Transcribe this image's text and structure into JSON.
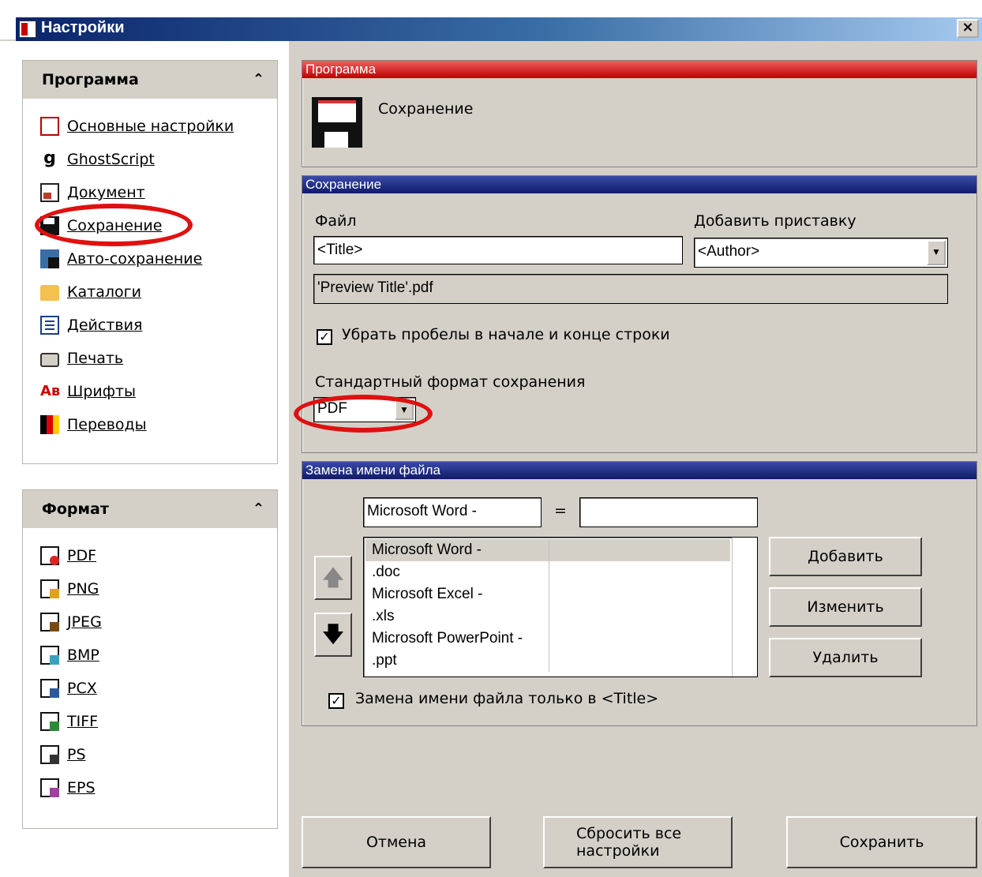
{
  "window": {
    "title": "Настройки",
    "close_label": "×"
  },
  "sidebar": {
    "program": {
      "title": "Программа",
      "chevron": "⌃",
      "items": [
        {
          "label": "Основные настройки",
          "icon": "settings-doc-icon"
        },
        {
          "label": "GhostScript",
          "icon": "ghostscript-icon"
        },
        {
          "label": "Документ",
          "icon": "document-icon"
        },
        {
          "label": "Сохранение",
          "icon": "save-disk-icon"
        },
        {
          "label": "Авто-сохранение",
          "icon": "autosave-icon"
        },
        {
          "label": "Каталоги",
          "icon": "folder-icon"
        },
        {
          "label": "Действия",
          "icon": "actions-list-icon"
        },
        {
          "label": "Печать",
          "icon": "printer-icon"
        },
        {
          "label": "Шрифты",
          "icon": "fonts-icon"
        },
        {
          "label": "Переводы",
          "icon": "translations-flag-icon"
        }
      ]
    },
    "format": {
      "title": "Формат",
      "chevron": "⌃",
      "items": [
        {
          "label": "PDF",
          "icon": "pdf-icon"
        },
        {
          "label": "PNG",
          "icon": "png-icon"
        },
        {
          "label": "JPEG",
          "icon": "jpeg-icon"
        },
        {
          "label": "BMP",
          "icon": "bmp-icon"
        },
        {
          "label": "PCX",
          "icon": "pcx-icon"
        },
        {
          "label": "TIFF",
          "icon": "tiff-icon"
        },
        {
          "label": "PS",
          "icon": "ps-icon"
        },
        {
          "label": "EPS",
          "icon": "eps-icon"
        }
      ]
    }
  },
  "program_group": {
    "title": "Программа",
    "section": "Сохранение",
    "icon": "floppy-disk-icon"
  },
  "save_group": {
    "title": "Сохранение",
    "file_label": "Файл",
    "file_value": "<Title>",
    "prefix_label": "Добавить приставку",
    "prefix_value": "<Author>",
    "preview": "'Preview Title'.pdf",
    "trim_label": "Убрать пробелы в начале и конце строки",
    "trim_checked": "✓",
    "format_label": "Стандартный формат сохранения",
    "format_value": "PDF"
  },
  "rename_group": {
    "title": "Замена имени файла",
    "search_value": "Microsoft Word -",
    "equals": "=",
    "replace_value": "",
    "rows": [
      {
        "from": "Microsoft Word -",
        "to": ""
      },
      {
        "from": ".doc",
        "to": ""
      },
      {
        "from": "Microsoft Excel -",
        "to": ""
      },
      {
        "from": ".xls",
        "to": ""
      },
      {
        "from": "Microsoft PowerPoint -",
        "to": ""
      },
      {
        "from": ".ppt",
        "to": ""
      }
    ],
    "add_label": "Добавить",
    "edit_label": "Изменить",
    "delete_label": "Удалить",
    "up_arrow": "🡅",
    "down_arrow": "🡇",
    "title_only_label": "Замена имени файла только в <Title>",
    "title_only_checked": "✓"
  },
  "footer": {
    "cancel_label": "Отмена",
    "reset_label": "Сбросить все настройки",
    "save_label": "Сохранить"
  },
  "colors": {
    "title_bar": "#0a246a",
    "red_header": "#c00000",
    "blue_header": "#101a6a",
    "annotation": "#e01010"
  }
}
